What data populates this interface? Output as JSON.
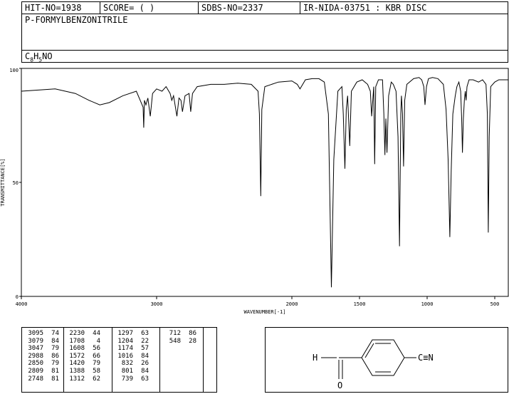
{
  "header": {
    "hit_no": "HIT-NO=1938",
    "score": "SCORE=  (  )",
    "sdbs_no": "SDBS-NO=2337",
    "ir_info": "IR-NIDA-03751 : KBR DISC"
  },
  "compound": {
    "name": "P-FORMYLBENZONITRILE",
    "formula_c": "C",
    "formula_c_sub": "8",
    "formula_h": "H",
    "formula_h_sub": "5",
    "formula_rest": "NO"
  },
  "chart_data": {
    "type": "line",
    "xlabel": "WAVENUMBER[-1]",
    "ylabel": "TRANSMITTANCE[%]",
    "xlim": [
      4000,
      400
    ],
    "ylim": [
      0,
      100
    ],
    "x_ticks": [
      4000,
      3000,
      2000,
      1500,
      1000,
      500
    ],
    "y_ticks": [
      0,
      50,
      100
    ],
    "grid": false,
    "legend": "none",
    "series": [
      {
        "x": [
          4000,
          3750,
          3600,
          3500,
          3420,
          3350,
          3250,
          3150,
          3100,
          3095,
          3090,
          3079,
          3065,
          3047,
          3030,
          3000,
          2960,
          2930,
          2900,
          2888,
          2875,
          2850,
          2835,
          2820,
          2809,
          2790,
          2760,
          2748,
          2735,
          2700,
          2600,
          2500,
          2400,
          2300,
          2250,
          2240,
          2230,
          2222,
          2200,
          2100,
          2000,
          1960,
          1940,
          1930,
          1900,
          1850,
          1800,
          1760,
          1730,
          1708,
          1690,
          1660,
          1630,
          1620,
          1608,
          1598,
          1588,
          1572,
          1560,
          1520,
          1480,
          1440,
          1420,
          1410,
          1395,
          1388,
          1380,
          1360,
          1330,
          1320,
          1312,
          1305,
          1297,
          1285,
          1265,
          1250,
          1230,
          1215,
          1204,
          1195,
          1190,
          1182,
          1174,
          1166,
          1150,
          1100,
          1060,
          1040,
          1025,
          1016,
          1005,
          990,
          960,
          920,
          880,
          860,
          845,
          832,
          822,
          810,
          801,
          792,
          780,
          765,
          752,
          745,
          739,
          732,
          725,
          718,
          712,
          705,
          690,
          660,
          620,
          590,
          565,
          555,
          548,
          541,
          530,
          500,
          470,
          450,
          400
        ],
        "y": [
          90,
          91,
          89,
          86,
          84,
          85,
          88,
          90,
          83,
          74,
          86,
          84,
          87,
          79,
          89,
          91,
          90,
          92,
          89,
          86,
          88,
          79,
          87,
          86,
          81,
          88,
          89,
          81,
          89,
          92,
          93,
          93,
          93.5,
          93,
          90,
          80,
          44,
          82,
          92,
          94,
          94.5,
          93,
          91,
          92,
          95,
          95.5,
          95.5,
          94,
          80,
          4,
          60,
          90,
          92,
          80,
          56,
          82,
          88,
          66,
          90,
          94,
          95,
          93,
          90,
          79,
          92,
          58,
          92,
          95,
          95,
          80,
          62,
          78,
          63,
          88,
          94,
          93,
          90,
          70,
          22,
          80,
          88,
          80,
          57,
          86,
          93,
          95.5,
          96,
          95,
          92,
          84,
          92,
          95.5,
          96,
          95.5,
          93,
          82,
          60,
          26,
          55,
          80,
          84,
          88,
          92,
          94,
          90,
          78,
          63,
          78,
          86,
          90,
          86,
          92,
          95,
          95,
          94,
          95,
          93,
          80,
          28,
          70,
          92,
          94,
          95,
          95,
          95
        ]
      }
    ]
  },
  "peak_table": {
    "columns": [
      [
        [
          "3095",
          "74"
        ],
        [
          "3079",
          "84"
        ],
        [
          "3047",
          "79"
        ],
        [
          "2988",
          "86"
        ],
        [
          "2850",
          "79"
        ],
        [
          "2809",
          "81"
        ],
        [
          "2748",
          "81"
        ]
      ],
      [
        [
          "2230",
          "44"
        ],
        [
          "1708",
          "4"
        ],
        [
          "1608",
          "56"
        ],
        [
          "1572",
          "66"
        ],
        [
          "1420",
          "79"
        ],
        [
          "1388",
          "58"
        ],
        [
          "1312",
          "62"
        ]
      ],
      [
        [
          "1297",
          "63"
        ],
        [
          "1204",
          "22"
        ],
        [
          "1174",
          "57"
        ],
        [
          "1016",
          "84"
        ],
        [
          "832",
          "26"
        ],
        [
          "801",
          "84"
        ],
        [
          "739",
          "63"
        ]
      ],
      [
        [
          "712",
          "86"
        ],
        [
          "548",
          "28"
        ]
      ]
    ]
  },
  "structure": {
    "h_label": "H",
    "o_label": "O",
    "cn_label": "C≡N"
  }
}
